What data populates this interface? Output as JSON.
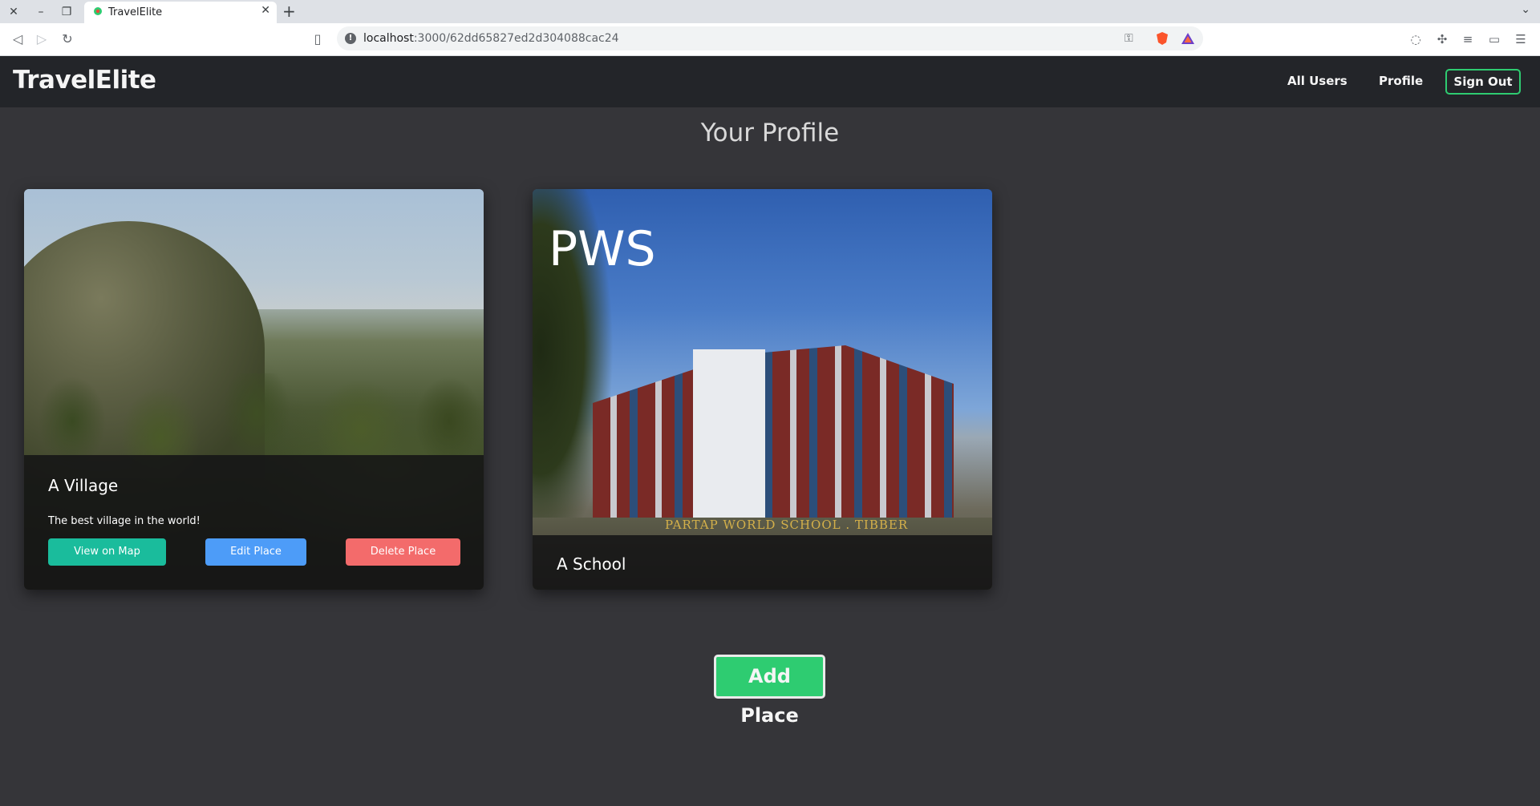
{
  "browser": {
    "tab_title": "TravelElite",
    "url_host": "localhost",
    "url_path": ":3000/62dd65827ed2d304088cac24"
  },
  "navbar": {
    "brand": "TravelElite",
    "links": [
      "All Users",
      "Profile"
    ],
    "sign_out": "Sign Out"
  },
  "page": {
    "title": "Your Profile"
  },
  "places": [
    {
      "title": "A Village",
      "description": "The best village in the world!",
      "buttons": {
        "view": "View on Map",
        "edit": "Edit Place",
        "delete": "Delete Place"
      }
    },
    {
      "title": "A School",
      "image_text": "PWS",
      "image_caption": "PARTAP WORLD SCHOOL . TIBBER"
    }
  ],
  "add_place": "Add Place",
  "colors": {
    "background": "#353539",
    "navbar": "#232529",
    "accent_green": "#2ecc71",
    "teal": "#1abc9c",
    "blue": "#4d9cf8",
    "red": "#f36b6b"
  }
}
